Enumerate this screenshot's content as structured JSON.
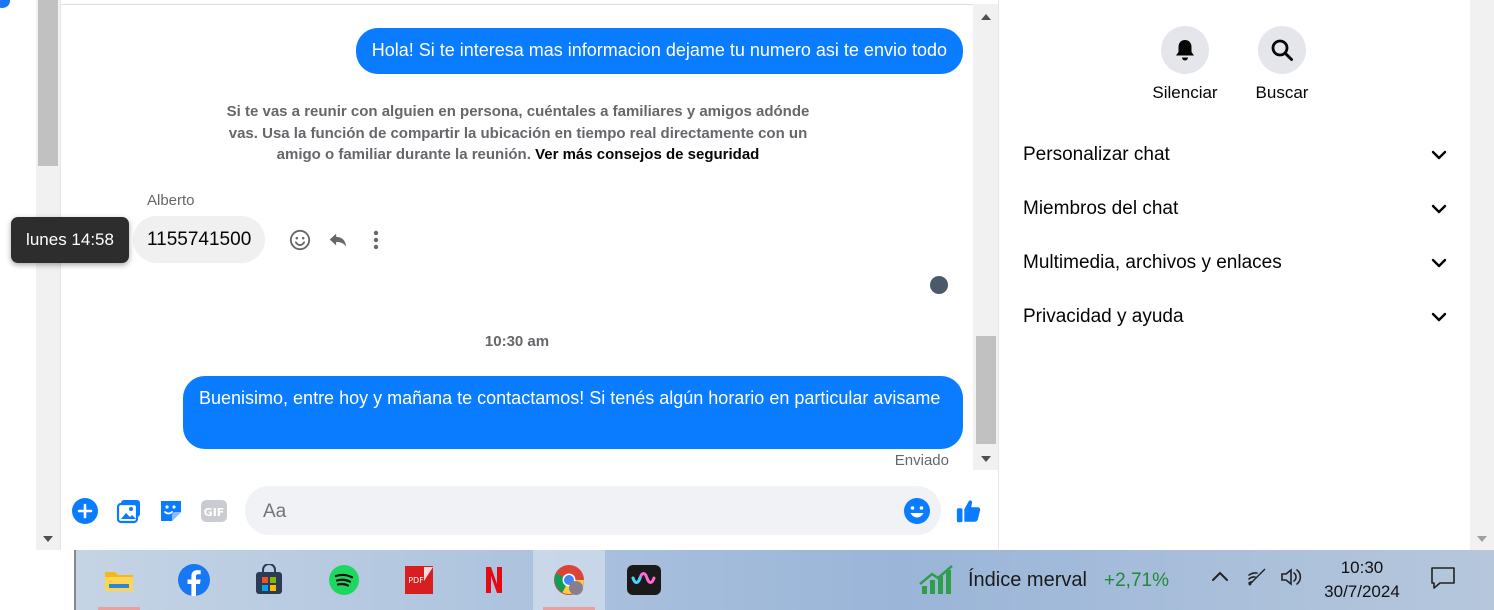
{
  "chat": {
    "outgoing_1": "Hola! Si te interesa mas informacion dejame tu numero asi te envio todo",
    "safety_notice": "Si te vas a reunir con alguien en persona, cuéntales a familiares y amigos adónde vas. Usa la función de compartir la ubicación en tiempo real directamente con un amigo o familiar durante la reunión.",
    "safety_link": "Ver más consejos de seguridad",
    "sender_name": "Alberto",
    "incoming_1": "1155741500",
    "tooltip": "lunes 14:58",
    "timestamp": "10:30 am",
    "outgoing_2": "Buenisimo, entre hoy y mañana te contactamos! Si tenés algún horario en particular avisame",
    "status": "Enviado",
    "composer_placeholder": "Aa"
  },
  "actions": {
    "mute_label": "Silenciar",
    "search_label": "Buscar"
  },
  "sections": [
    {
      "label": "Personalizar chat"
    },
    {
      "label": "Miembros del chat"
    },
    {
      "label": "Multimedia, archivos y enlaces"
    },
    {
      "label": "Privacidad y ayuda"
    }
  ],
  "taskbar": {
    "widget_label": "Índice merval",
    "widget_value": "+2,71%",
    "time": "10:30",
    "date": "30/7/2024",
    "apps": [
      "file-explorer-icon",
      "facebook-icon",
      "microsoft-store-icon",
      "spotify-icon",
      "pdf-editor-icon",
      "netflix-icon",
      "chrome-icon",
      "wavebox-icon"
    ]
  },
  "colors": {
    "messenger_blue": "#0a7cff",
    "bubble_grey": "#f0f0f0",
    "muted_text": "#65676b",
    "market_green": "#1f8a36"
  }
}
